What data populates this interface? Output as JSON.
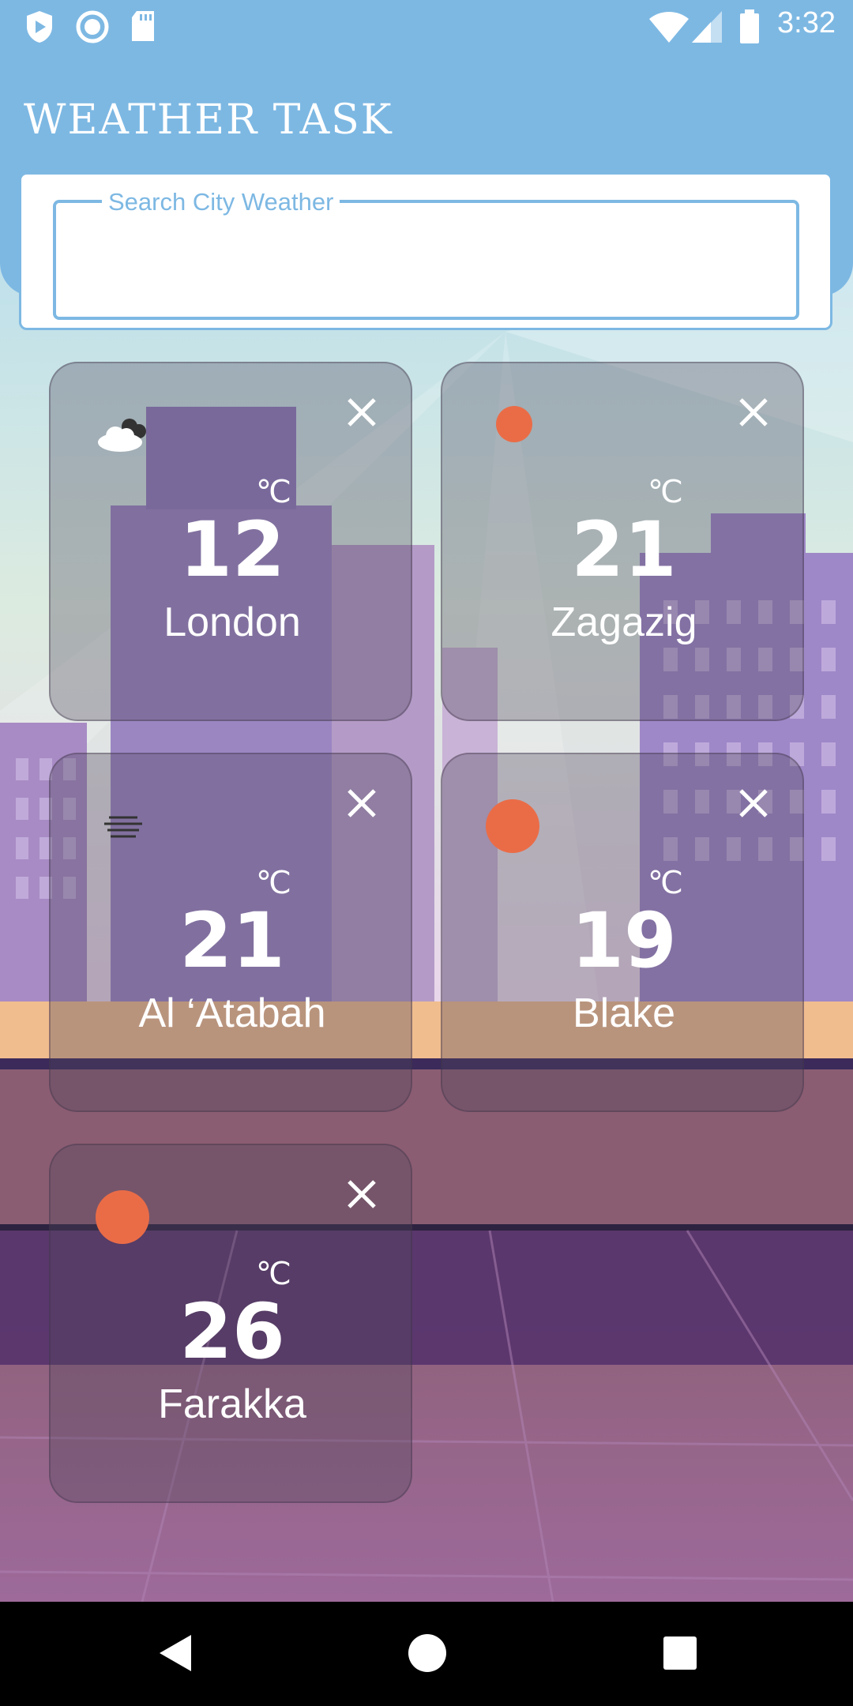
{
  "status_bar": {
    "time": "3:32"
  },
  "app_title": "WEATHER TASK",
  "search": {
    "label": "Search City Weather",
    "value": ""
  },
  "cards": [
    {
      "temp": "12",
      "unit": "℃",
      "city": "London",
      "icon": "cloud-icon"
    },
    {
      "temp": "21",
      "unit": "℃",
      "city": "Zagazig",
      "icon": "sun-icon"
    },
    {
      "temp": "21",
      "unit": "℃",
      "city": "Al ‘Atabah",
      "icon": "haze-icon"
    },
    {
      "temp": "19",
      "unit": "℃",
      "city": "Blake",
      "icon": "sun-icon"
    },
    {
      "temp": "26",
      "unit": "℃",
      "city": "Farakka",
      "icon": "sun-icon"
    }
  ],
  "colors": {
    "header": "#7db8e3",
    "sun": "#ea6c47",
    "card_text": "#ffffff"
  }
}
